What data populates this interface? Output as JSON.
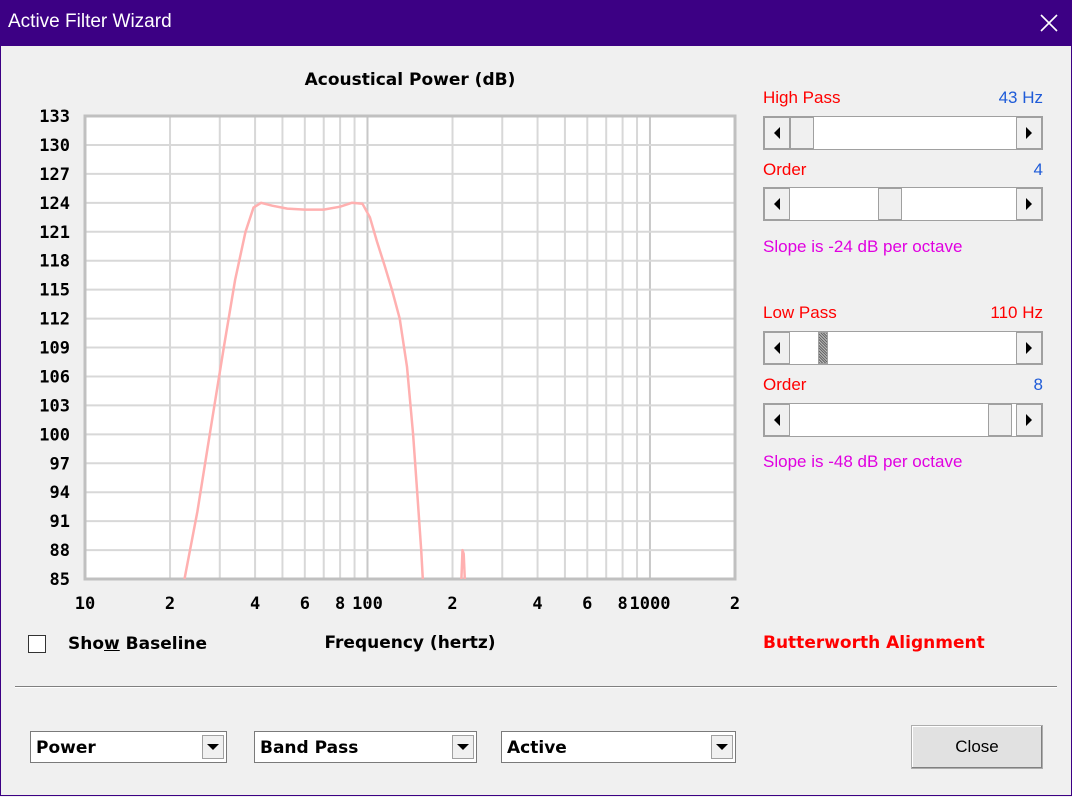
{
  "window": {
    "title": "Active Filter Wizard"
  },
  "chart_data": {
    "type": "line",
    "title": "Acoustical Power (dB)",
    "xlabel": "Frequency (hertz)",
    "ylabel": "",
    "x_scale": "log",
    "xlim": [
      10,
      2000
    ],
    "ylim": [
      85,
      133
    ],
    "y_ticks": [
      133,
      130,
      127,
      124,
      121,
      118,
      115,
      112,
      109,
      106,
      103,
      100,
      97,
      94,
      91,
      88,
      85
    ],
    "x_ticks": [
      {
        "v": 10,
        "label": "10"
      },
      {
        "v": 20,
        "label": "2"
      },
      {
        "v": 40,
        "label": "4"
      },
      {
        "v": 60,
        "label": "6"
      },
      {
        "v": 80,
        "label": "8"
      },
      {
        "v": 100,
        "label": "100"
      },
      {
        "v": 200,
        "label": "2"
      },
      {
        "v": 400,
        "label": "4"
      },
      {
        "v": 600,
        "label": "6"
      },
      {
        "v": 800,
        "label": "8"
      },
      {
        "v": 1000,
        "label": "1000"
      },
      {
        "v": 2000,
        "label": "2"
      }
    ],
    "grid": true,
    "line_color": "#ffb0b0",
    "series": [
      {
        "x": [
          22.5,
          25,
          28,
          31,
          34,
          37,
          39.5,
          42,
          46,
          52,
          60,
          70,
          80,
          88,
          96,
          102,
          108,
          115,
          122,
          130,
          138,
          145,
          150,
          155,
          157
        ],
        "y": [
          85,
          92,
          101,
          109,
          116,
          121,
          123.5,
          124,
          123.7,
          123.4,
          123.3,
          123.3,
          123.6,
          124,
          123.9,
          122.5,
          120,
          117.5,
          115,
          112,
          107,
          100,
          94,
          88,
          85
        ]
      },
      {
        "x": [
          215,
          217,
          219,
          221
        ],
        "y": [
          85,
          88,
          87.6,
          85
        ]
      }
    ]
  },
  "baseline": {
    "label_pre": "Sho",
    "label_key": "w",
    "label_post": " Baseline",
    "checked": false
  },
  "high_pass": {
    "label": "High Pass",
    "value": "43 Hz",
    "position": 0.03
  },
  "hp_order": {
    "label": "Order",
    "value": "4",
    "position": 0.43
  },
  "hp_slope": "Slope is -24 dB per octave",
  "low_pass": {
    "label": "Low Pass",
    "value": "110 Hz",
    "position": 0.12
  },
  "lp_order": {
    "label": "Order",
    "value": "8",
    "position": 1.0
  },
  "lp_slope": "Slope is -48 dB per octave",
  "alignment": "Butterworth Alignment",
  "combos": {
    "plot": "Power",
    "filter_type": "Band Pass",
    "mode": "Active"
  },
  "close_label": "Close",
  "colors": {
    "titlebar": "#3c0084",
    "red_label": "#ff0000",
    "blue_value": "#1e5bd8",
    "magenta": "#e000e0"
  }
}
